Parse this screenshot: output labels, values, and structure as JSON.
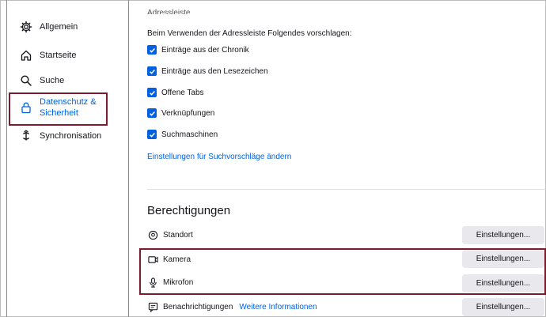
{
  "sidebar": {
    "items": [
      {
        "label": "Allgemein",
        "icon": "gear-icon"
      },
      {
        "label": "Startseite",
        "icon": "home-icon"
      },
      {
        "label": "Suche",
        "icon": "search-icon"
      },
      {
        "label_line1": "Datenschutz &",
        "label_line2": "Sicherheit",
        "icon": "lock-icon",
        "active": true
      },
      {
        "label": "Synchronisation",
        "icon": "sync-icon"
      }
    ]
  },
  "address_bar": {
    "heading_cut": "Adressleiste",
    "intro": "Beim Verwenden der Adressleiste Folgendes vorschlagen:",
    "options": [
      {
        "label": "Einträge aus der Chronik",
        "checked": true
      },
      {
        "label": "Einträge aus den Lesezeichen",
        "checked": true
      },
      {
        "label": "Offene Tabs",
        "checked": true
      },
      {
        "label": "Verknüpfungen",
        "checked": true
      },
      {
        "label": "Suchmaschinen",
        "checked": true
      }
    ],
    "suggestions_link": "Einstellungen für Suchvorschläge ändern"
  },
  "permissions": {
    "title": "Berechtigungen",
    "button_label": "Einstellungen...",
    "rows": [
      {
        "label": "Standort",
        "icon": "location-icon"
      },
      {
        "label": "Kamera",
        "icon": "camera-icon"
      },
      {
        "label": "Mikrofon",
        "icon": "microphone-icon"
      },
      {
        "label": "Benachrichtigungen",
        "icon": "notification-icon",
        "link": "Weitere Informationen"
      }
    ]
  },
  "colors": {
    "accent": "#0061e0",
    "highlight": "#7a1c2e",
    "button_bg": "#e8e8ed"
  }
}
